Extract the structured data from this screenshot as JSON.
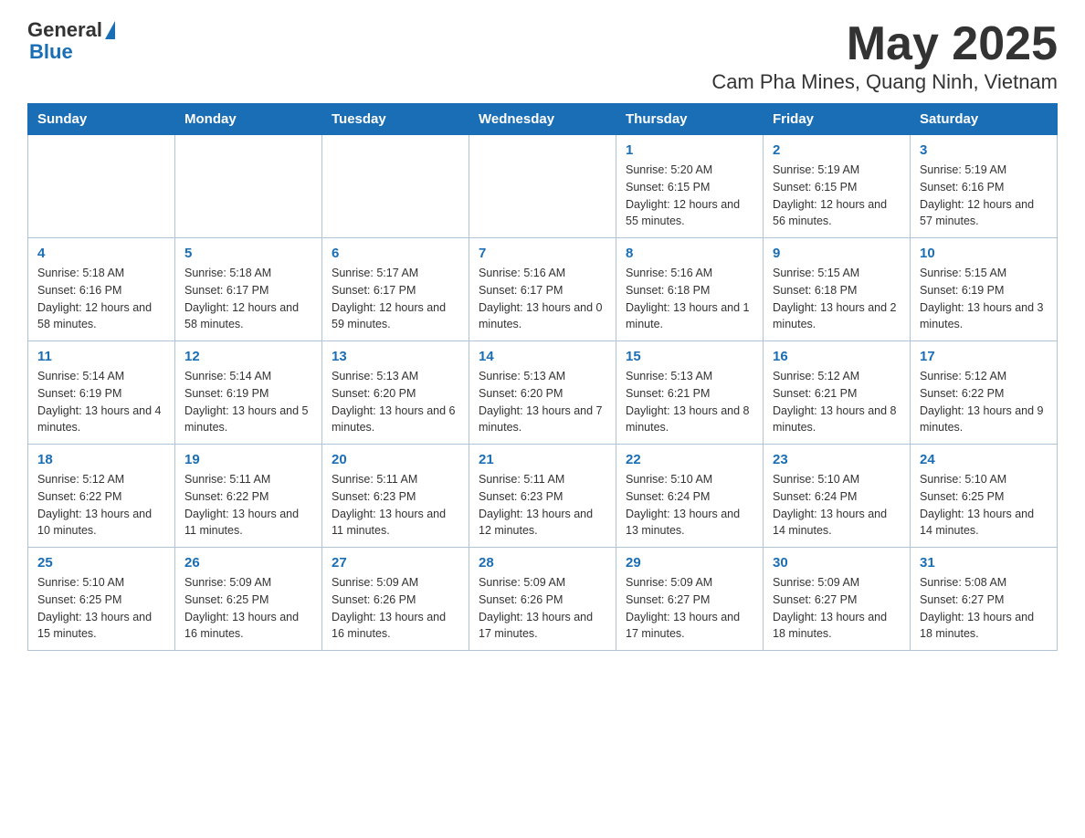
{
  "header": {
    "logo": {
      "text_general": "General",
      "text_arrow": "▲",
      "text_blue": "Blue"
    },
    "title": "May 2025",
    "subtitle": "Cam Pha Mines, Quang Ninh, Vietnam"
  },
  "calendar": {
    "days_of_week": [
      "Sunday",
      "Monday",
      "Tuesday",
      "Wednesday",
      "Thursday",
      "Friday",
      "Saturday"
    ],
    "weeks": [
      {
        "cells": [
          {
            "day": "",
            "info": ""
          },
          {
            "day": "",
            "info": ""
          },
          {
            "day": "",
            "info": ""
          },
          {
            "day": "",
            "info": ""
          },
          {
            "day": "1",
            "info": "Sunrise: 5:20 AM\nSunset: 6:15 PM\nDaylight: 12 hours\nand 55 minutes."
          },
          {
            "day": "2",
            "info": "Sunrise: 5:19 AM\nSunset: 6:15 PM\nDaylight: 12 hours\nand 56 minutes."
          },
          {
            "day": "3",
            "info": "Sunrise: 5:19 AM\nSunset: 6:16 PM\nDaylight: 12 hours\nand 57 minutes."
          }
        ]
      },
      {
        "cells": [
          {
            "day": "4",
            "info": "Sunrise: 5:18 AM\nSunset: 6:16 PM\nDaylight: 12 hours\nand 58 minutes."
          },
          {
            "day": "5",
            "info": "Sunrise: 5:18 AM\nSunset: 6:17 PM\nDaylight: 12 hours\nand 58 minutes."
          },
          {
            "day": "6",
            "info": "Sunrise: 5:17 AM\nSunset: 6:17 PM\nDaylight: 12 hours\nand 59 minutes."
          },
          {
            "day": "7",
            "info": "Sunrise: 5:16 AM\nSunset: 6:17 PM\nDaylight: 13 hours\nand 0 minutes."
          },
          {
            "day": "8",
            "info": "Sunrise: 5:16 AM\nSunset: 6:18 PM\nDaylight: 13 hours\nand 1 minute."
          },
          {
            "day": "9",
            "info": "Sunrise: 5:15 AM\nSunset: 6:18 PM\nDaylight: 13 hours\nand 2 minutes."
          },
          {
            "day": "10",
            "info": "Sunrise: 5:15 AM\nSunset: 6:19 PM\nDaylight: 13 hours\nand 3 minutes."
          }
        ]
      },
      {
        "cells": [
          {
            "day": "11",
            "info": "Sunrise: 5:14 AM\nSunset: 6:19 PM\nDaylight: 13 hours\nand 4 minutes."
          },
          {
            "day": "12",
            "info": "Sunrise: 5:14 AM\nSunset: 6:19 PM\nDaylight: 13 hours\nand 5 minutes."
          },
          {
            "day": "13",
            "info": "Sunrise: 5:13 AM\nSunset: 6:20 PM\nDaylight: 13 hours\nand 6 minutes."
          },
          {
            "day": "14",
            "info": "Sunrise: 5:13 AM\nSunset: 6:20 PM\nDaylight: 13 hours\nand 7 minutes."
          },
          {
            "day": "15",
            "info": "Sunrise: 5:13 AM\nSunset: 6:21 PM\nDaylight: 13 hours\nand 8 minutes."
          },
          {
            "day": "16",
            "info": "Sunrise: 5:12 AM\nSunset: 6:21 PM\nDaylight: 13 hours\nand 8 minutes."
          },
          {
            "day": "17",
            "info": "Sunrise: 5:12 AM\nSunset: 6:22 PM\nDaylight: 13 hours\nand 9 minutes."
          }
        ]
      },
      {
        "cells": [
          {
            "day": "18",
            "info": "Sunrise: 5:12 AM\nSunset: 6:22 PM\nDaylight: 13 hours\nand 10 minutes."
          },
          {
            "day": "19",
            "info": "Sunrise: 5:11 AM\nSunset: 6:22 PM\nDaylight: 13 hours\nand 11 minutes."
          },
          {
            "day": "20",
            "info": "Sunrise: 5:11 AM\nSunset: 6:23 PM\nDaylight: 13 hours\nand 11 minutes."
          },
          {
            "day": "21",
            "info": "Sunrise: 5:11 AM\nSunset: 6:23 PM\nDaylight: 13 hours\nand 12 minutes."
          },
          {
            "day": "22",
            "info": "Sunrise: 5:10 AM\nSunset: 6:24 PM\nDaylight: 13 hours\nand 13 minutes."
          },
          {
            "day": "23",
            "info": "Sunrise: 5:10 AM\nSunset: 6:24 PM\nDaylight: 13 hours\nand 14 minutes."
          },
          {
            "day": "24",
            "info": "Sunrise: 5:10 AM\nSunset: 6:25 PM\nDaylight: 13 hours\nand 14 minutes."
          }
        ]
      },
      {
        "cells": [
          {
            "day": "25",
            "info": "Sunrise: 5:10 AM\nSunset: 6:25 PM\nDaylight: 13 hours\nand 15 minutes."
          },
          {
            "day": "26",
            "info": "Sunrise: 5:09 AM\nSunset: 6:25 PM\nDaylight: 13 hours\nand 16 minutes."
          },
          {
            "day": "27",
            "info": "Sunrise: 5:09 AM\nSunset: 6:26 PM\nDaylight: 13 hours\nand 16 minutes."
          },
          {
            "day": "28",
            "info": "Sunrise: 5:09 AM\nSunset: 6:26 PM\nDaylight: 13 hours\nand 17 minutes."
          },
          {
            "day": "29",
            "info": "Sunrise: 5:09 AM\nSunset: 6:27 PM\nDaylight: 13 hours\nand 17 minutes."
          },
          {
            "day": "30",
            "info": "Sunrise: 5:09 AM\nSunset: 6:27 PM\nDaylight: 13 hours\nand 18 minutes."
          },
          {
            "day": "31",
            "info": "Sunrise: 5:08 AM\nSunset: 6:27 PM\nDaylight: 13 hours\nand 18 minutes."
          }
        ]
      }
    ]
  }
}
